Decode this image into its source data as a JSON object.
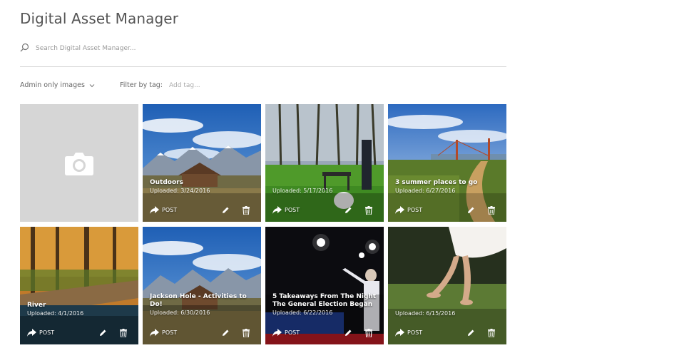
{
  "app": {
    "title": "Digital Asset Manager"
  },
  "search": {
    "placeholder": "Search Digital Asset Manager..."
  },
  "filters": {
    "visibility_label": "Admin only images",
    "tag_label": "Filter by tag:",
    "tag_placeholder": "Add tag..."
  },
  "actions": {
    "post_label": "POST"
  },
  "assets": [
    {
      "title": "Outdoors",
      "uploaded": "Uploaded: 3/24/2016"
    },
    {
      "title": "",
      "uploaded": "Uploaded: 5/17/2016"
    },
    {
      "title": "3 summer places to go",
      "uploaded": "Uploaded: 6/27/2016"
    },
    {
      "title": "River",
      "uploaded": "Uploaded: 4/1/2016"
    },
    {
      "title": "Jackson Hole - Activities to Do!",
      "uploaded": "Uploaded: 6/30/2016"
    },
    {
      "title": "5 Takeaways From The Night The General Election Began",
      "uploaded": "Uploaded: 6/22/2016"
    },
    {
      "title": "",
      "uploaded": "Uploaded: 6/15/2016"
    }
  ]
}
